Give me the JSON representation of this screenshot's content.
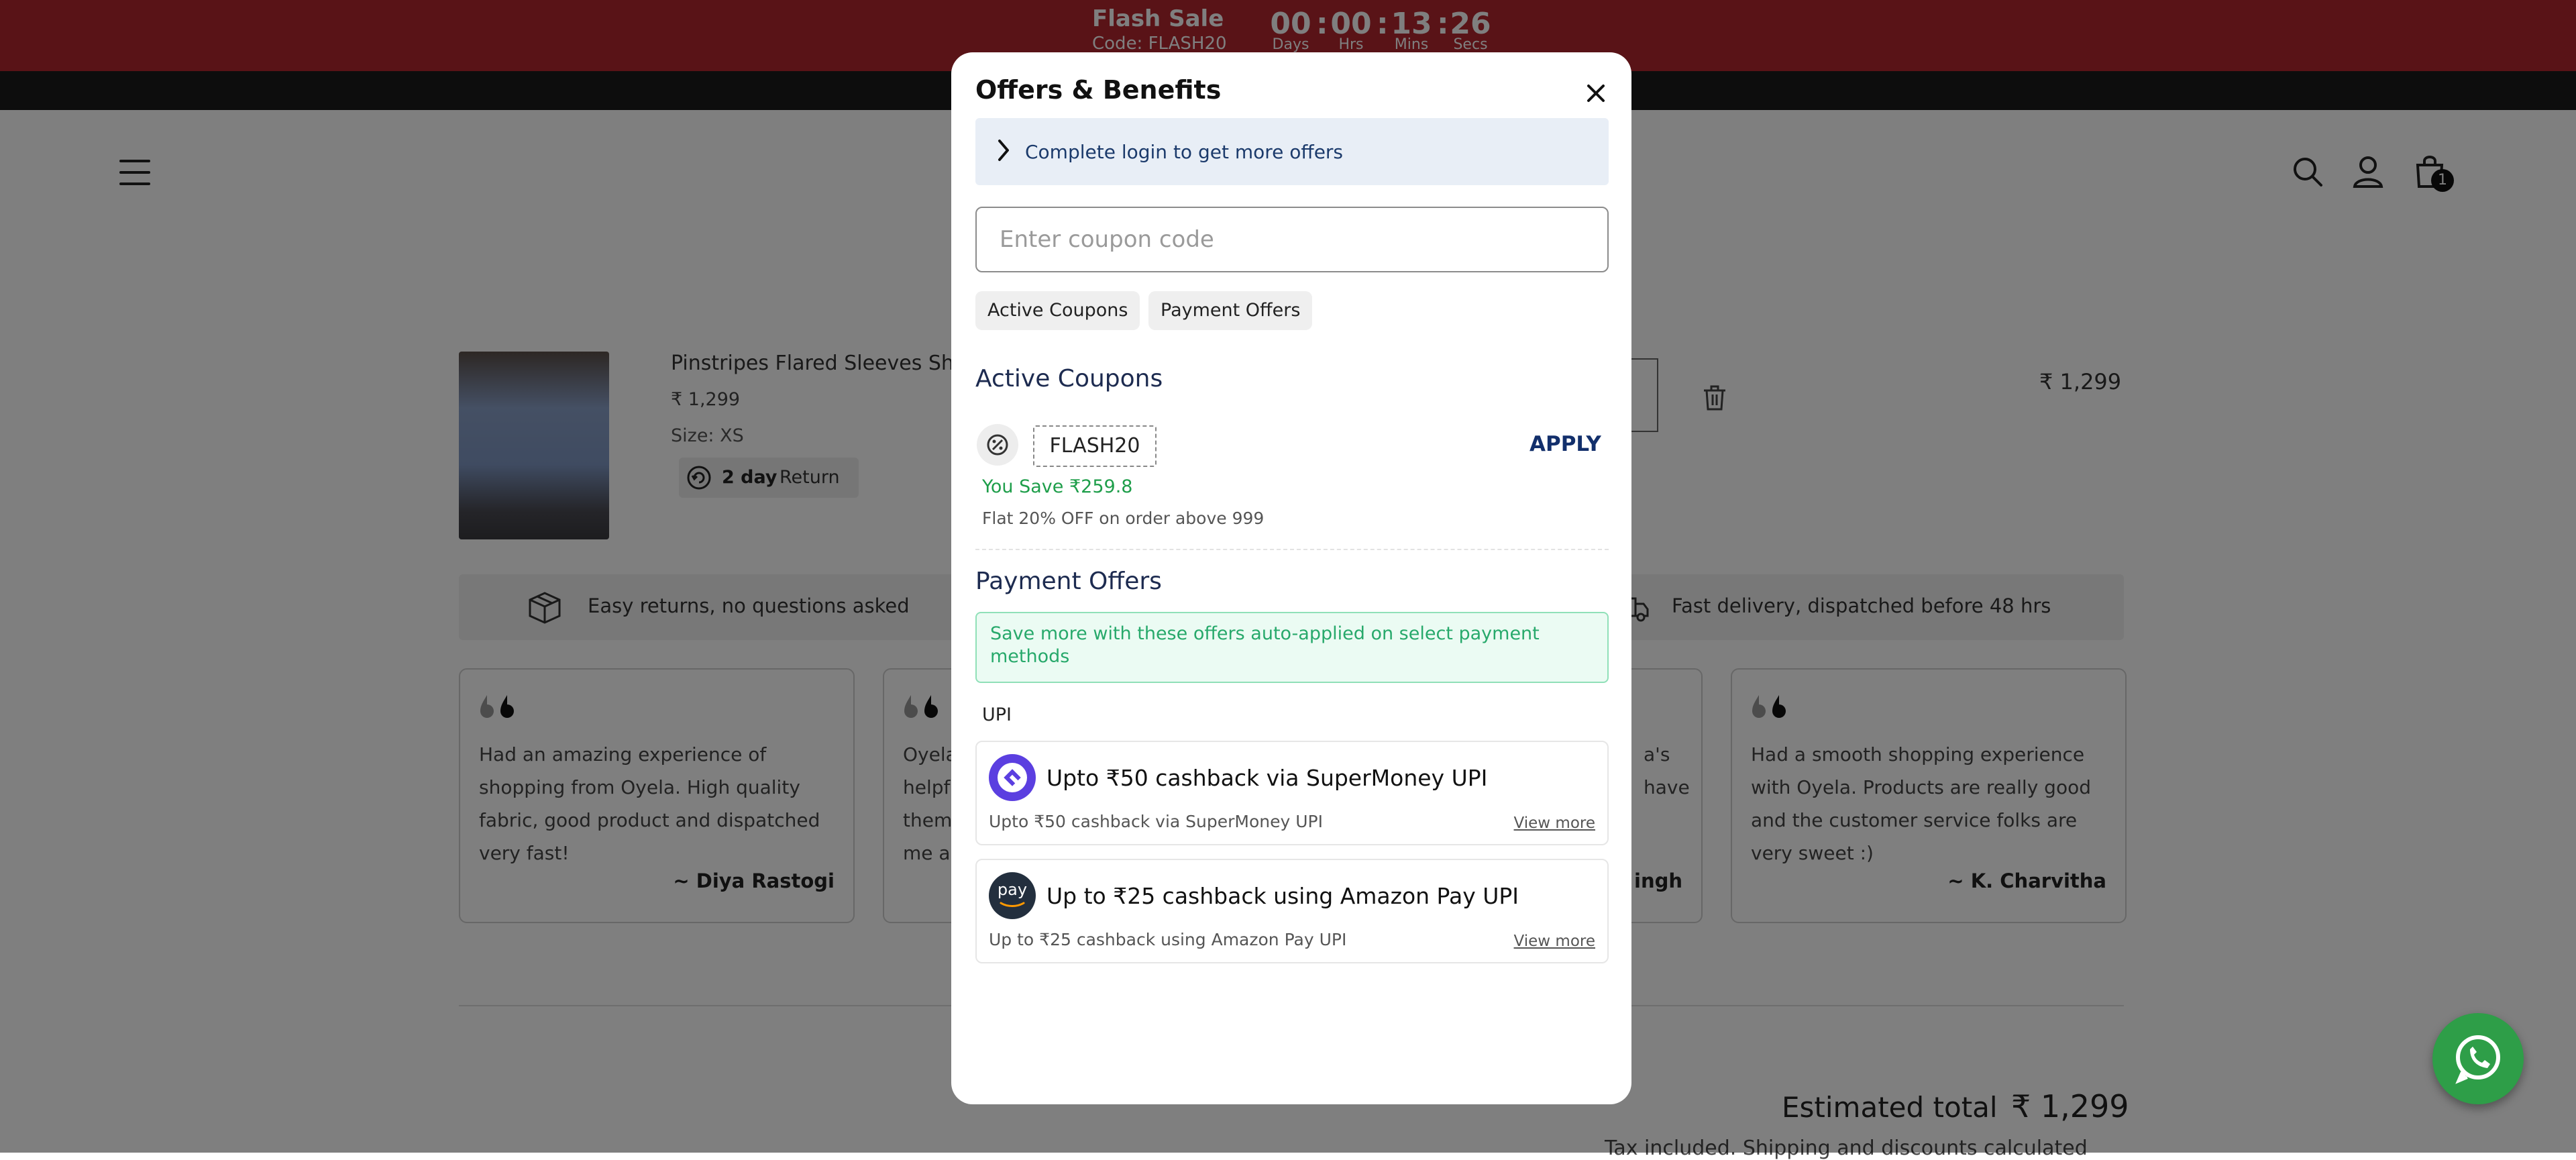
{
  "flash": {
    "title": "Flash Sale",
    "code": "Code: FLASH20",
    "countdown": [
      {
        "value": "00",
        "label": "Days"
      },
      {
        "value": "00",
        "label": "Hrs"
      },
      {
        "value": "13",
        "label": "Mins"
      },
      {
        "value": "26",
        "label": "Secs"
      }
    ]
  },
  "header": {
    "menu_icon": "hamburger-icon",
    "search_icon": "search-icon",
    "account_icon": "user-icon",
    "cart_icon": "bag-icon",
    "cart_count": "1"
  },
  "cart": {
    "item": {
      "title": "Pinstripes Flared Sleeves Sh",
      "price": "₹ 1,299",
      "size": "Size: XS",
      "return_days": "2 day",
      "return_word": "Return",
      "line_total": "₹ 1,299"
    },
    "benefits": [
      {
        "icon": "box-icon",
        "text": "Easy returns, no questions asked"
      },
      {
        "icon": "truck-icon",
        "text": "Fast delivery, dispatched before 48 hrs"
      }
    ],
    "reviews": [
      {
        "text": "Had an amazing experience of shopping from Oyela. High quality fabric, good product and dispatched very fast!",
        "name": "~ Diya Rastogi"
      },
      {
        "text": "Oyela helpf them me a",
        "name": ""
      },
      {
        "text": "a's have",
        "name": "ingh"
      },
      {
        "text": "Had a smooth shopping experience with Oyela. Products are really good and the customer service folks are very sweet :)",
        "name": "~ K. Charvitha"
      }
    ],
    "estimated_label": "Estimated total",
    "estimated_value": "₹ 1,299",
    "tax_note": "Tax included. Shipping and discounts calculated"
  },
  "modal": {
    "title": "Offers & Benefits",
    "login_text": "Complete login to get more offers",
    "coupon_placeholder": "Enter coupon code",
    "chips": [
      "Active Coupons",
      "Payment Offers"
    ],
    "active_coupons_title": "Active Coupons",
    "coupon": {
      "code": "FLASH20",
      "apply_label": "APPLY",
      "save_text": "You Save ₹259.8",
      "description": "Flat 20% OFF on order above 999"
    },
    "payment_offers_title": "Payment Offers",
    "payment_note": "Save more with these offers auto-applied on select payment methods",
    "upi_label": "UPI",
    "offers": [
      {
        "logo": "supermoney-logo-icon",
        "title": "Upto ₹50 cashback via SuperMoney UPI",
        "subtitle": "Upto ₹50 cashback via SuperMoney UPI",
        "link": "View more"
      },
      {
        "logo": "amazon-pay-logo-icon",
        "logo_text": "pay",
        "title": "Up to ₹25 cashback using Amazon Pay UPI",
        "subtitle": "Up to ₹25 cashback using Amazon Pay UPI",
        "link": "View more"
      }
    ]
  },
  "whatsapp_icon": "whatsapp-icon",
  "colors": {
    "flash_bar": "#b3262e",
    "accent_navy": "#122f6b",
    "success_green": "#1e9e4a",
    "whatsapp": "#2e9e48"
  }
}
